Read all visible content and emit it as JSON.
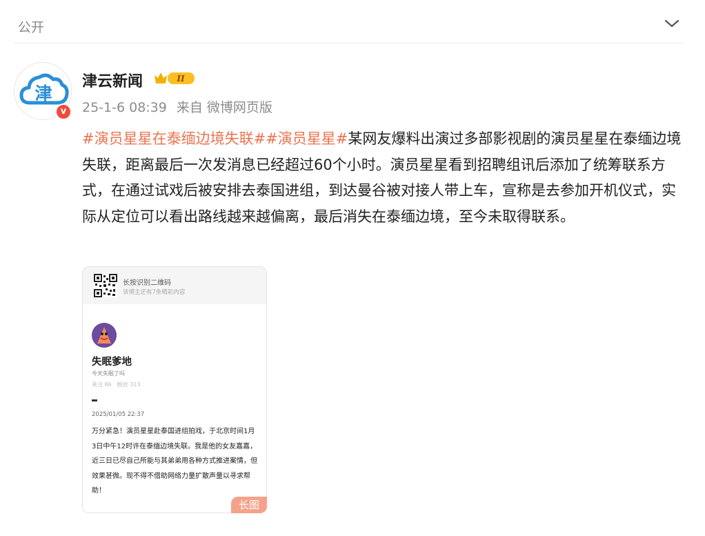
{
  "header": {
    "visibility": "公开"
  },
  "author": {
    "name": "津云新闻",
    "avatar_text": "津",
    "verified_mark": "v",
    "vip_level": "II"
  },
  "meta": {
    "time": "25-1-6 08:39",
    "source": "来自 微博网页版"
  },
  "post": {
    "hashtag1": "#演员星星在泰缅边境失联#",
    "hashtag2": "#演员星星#",
    "body": "某网友爆料出演过多部影视剧的演员星星在泰缅边境失联，距离最后一次发消息已经超过60个小时。演员星星看到招聘组讯后添加了统筹联系方式，在通过试戏后被安排去泰国进组，到达曼谷被对接人带上车，宣称是去参加开机仪式，实际从定位可以看出路线越来越偏离，最后消失在泰缅边境，至今未取得联系。"
  },
  "image_card": {
    "qr_title": "长按识别二维码",
    "qr_subtitle": "该博主还有7条精彩内容",
    "user_name": "失眠爹地",
    "user_bio": "今天失眠了吗",
    "following": "关注 86",
    "followers": "粉丝 313",
    "date": "2025/01/05 22:37",
    "body": "万分紧急！演员星星赴泰国进组拍戏，于北京时间1月3日中午12时许在泰缅边境失联。我是他的女友嘉嘉，近三日已尽自己所能与其弟弟用各种方式推进案情，但效果甚微。现不得不借助网络力量扩散声量以寻求帮助！",
    "long_tag": "长图"
  },
  "colors": {
    "hashtag": "#eb7350",
    "brand_blue": "#2b8fd8",
    "verified_red": "#f04a3c"
  }
}
